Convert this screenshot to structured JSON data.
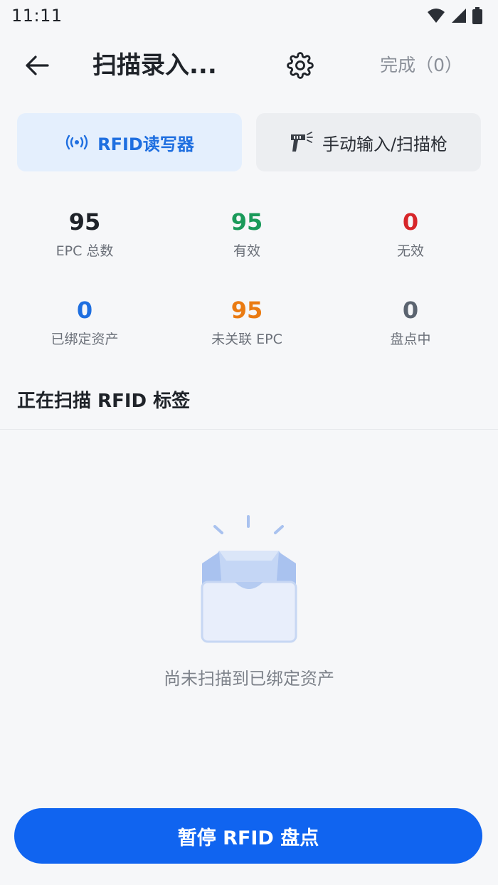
{
  "status_bar": {
    "time": "11:11",
    "icons": [
      "wifi-icon",
      "signal-icon",
      "battery-icon"
    ]
  },
  "app_bar": {
    "title": "扫描录入...",
    "done_label": "完成（0）",
    "icons": [
      "back-arrow-icon",
      "gear-icon"
    ]
  },
  "mode_tabs": [
    {
      "label": "RFID读写器",
      "icon": "rfid-signal-icon",
      "active": true
    },
    {
      "label": "手动输入/扫描枪",
      "icon": "barcode-scanner-icon",
      "active": false
    }
  ],
  "stats": [
    {
      "value": "95",
      "label": "EPC 总数",
      "color": "#1f2329"
    },
    {
      "value": "95",
      "label": "有效",
      "color": "#1a9a5a"
    },
    {
      "value": "0",
      "label": "无效",
      "color": "#d7262a"
    },
    {
      "value": "0",
      "label": "已绑定资产",
      "color": "#1f6fe0"
    },
    {
      "value": "95",
      "label": "未关联 EPC",
      "color": "#ea7b12"
    },
    {
      "value": "0",
      "label": "盘点中",
      "color": "#5b6470"
    }
  ],
  "section": {
    "title": "正在扫描 RFID 标签"
  },
  "empty_state": {
    "text": "尚未扫描到已绑定资产",
    "icon": "empty-box-icon"
  },
  "primary_button": {
    "label": "暂停 RFID 盘点",
    "color": "#1064f0"
  }
}
